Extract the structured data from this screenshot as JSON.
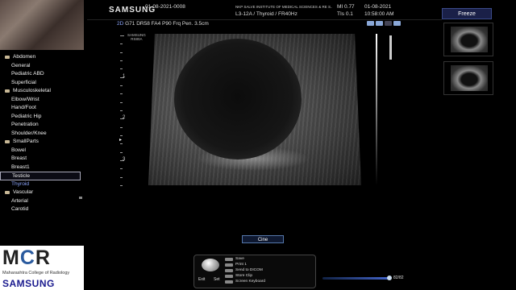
{
  "header": {
    "brand": "SAMSUNG",
    "patient_id": "01-08-2021-0008",
    "institution": "NKP SALVE INSTITUTE OF MEDICAL SCIENCES & RE S...",
    "probe_preset": "L3-12A / Thyroid / FR40Hz",
    "mi": "MI  0.77",
    "tis": "TIs  0.1",
    "date": "01-08-2021",
    "time": "10:58:00 AM"
  },
  "presets": [
    {
      "label": "Abdomen",
      "type": "group"
    },
    {
      "label": "General",
      "type": "child"
    },
    {
      "label": "Pediatric ABD",
      "type": "child"
    },
    {
      "label": "Superficial",
      "type": "child"
    },
    {
      "label": "Musculoskeletal",
      "type": "group"
    },
    {
      "label": "Elbow/Wrist",
      "type": "child"
    },
    {
      "label": "Hand/Foot",
      "type": "child"
    },
    {
      "label": "Pediatric Hip",
      "type": "child"
    },
    {
      "label": "Penetration",
      "type": "child"
    },
    {
      "label": "Shoulder/Knee",
      "type": "child"
    },
    {
      "label": "SmallParts",
      "type": "group"
    },
    {
      "label": "Bowel",
      "type": "child"
    },
    {
      "label": "Breast",
      "type": "child"
    },
    {
      "label": "Breast1",
      "type": "child"
    },
    {
      "label": "Testicle",
      "type": "child",
      "state": "selected"
    },
    {
      "label": "Thyroid",
      "type": "child",
      "state": "active"
    },
    {
      "label": "Vascular",
      "type": "group"
    },
    {
      "label": "Arterial",
      "type": "child"
    },
    {
      "label": "Carotid",
      "type": "child"
    }
  ],
  "logo": {
    "mcr_m": "M",
    "mcr_c": "C",
    "mcr_r": "R",
    "subtitle": "Maharashtra College of Radiology",
    "samsung": "SAMSUNG"
  },
  "image_params": {
    "mode": "2D",
    "settings": "G71 DR58 FA4 P90 Frq Pen. 3.5cm",
    "corner_logo": "SAMSUNG\nRS80A"
  },
  "depth_scale": {
    "labels": [
      "1",
      "2",
      "3"
    ]
  },
  "right_panel": {
    "freeze_label": "Freeze"
  },
  "bottom": {
    "cine_label": "Cine",
    "exit_label": "Exit",
    "set_label": "Set",
    "keyboard_items": [
      "Save",
      "Print 1",
      "Send to DICOM",
      "Store Clip",
      "Screen Keyboard"
    ],
    "frame_count": "82/82"
  }
}
